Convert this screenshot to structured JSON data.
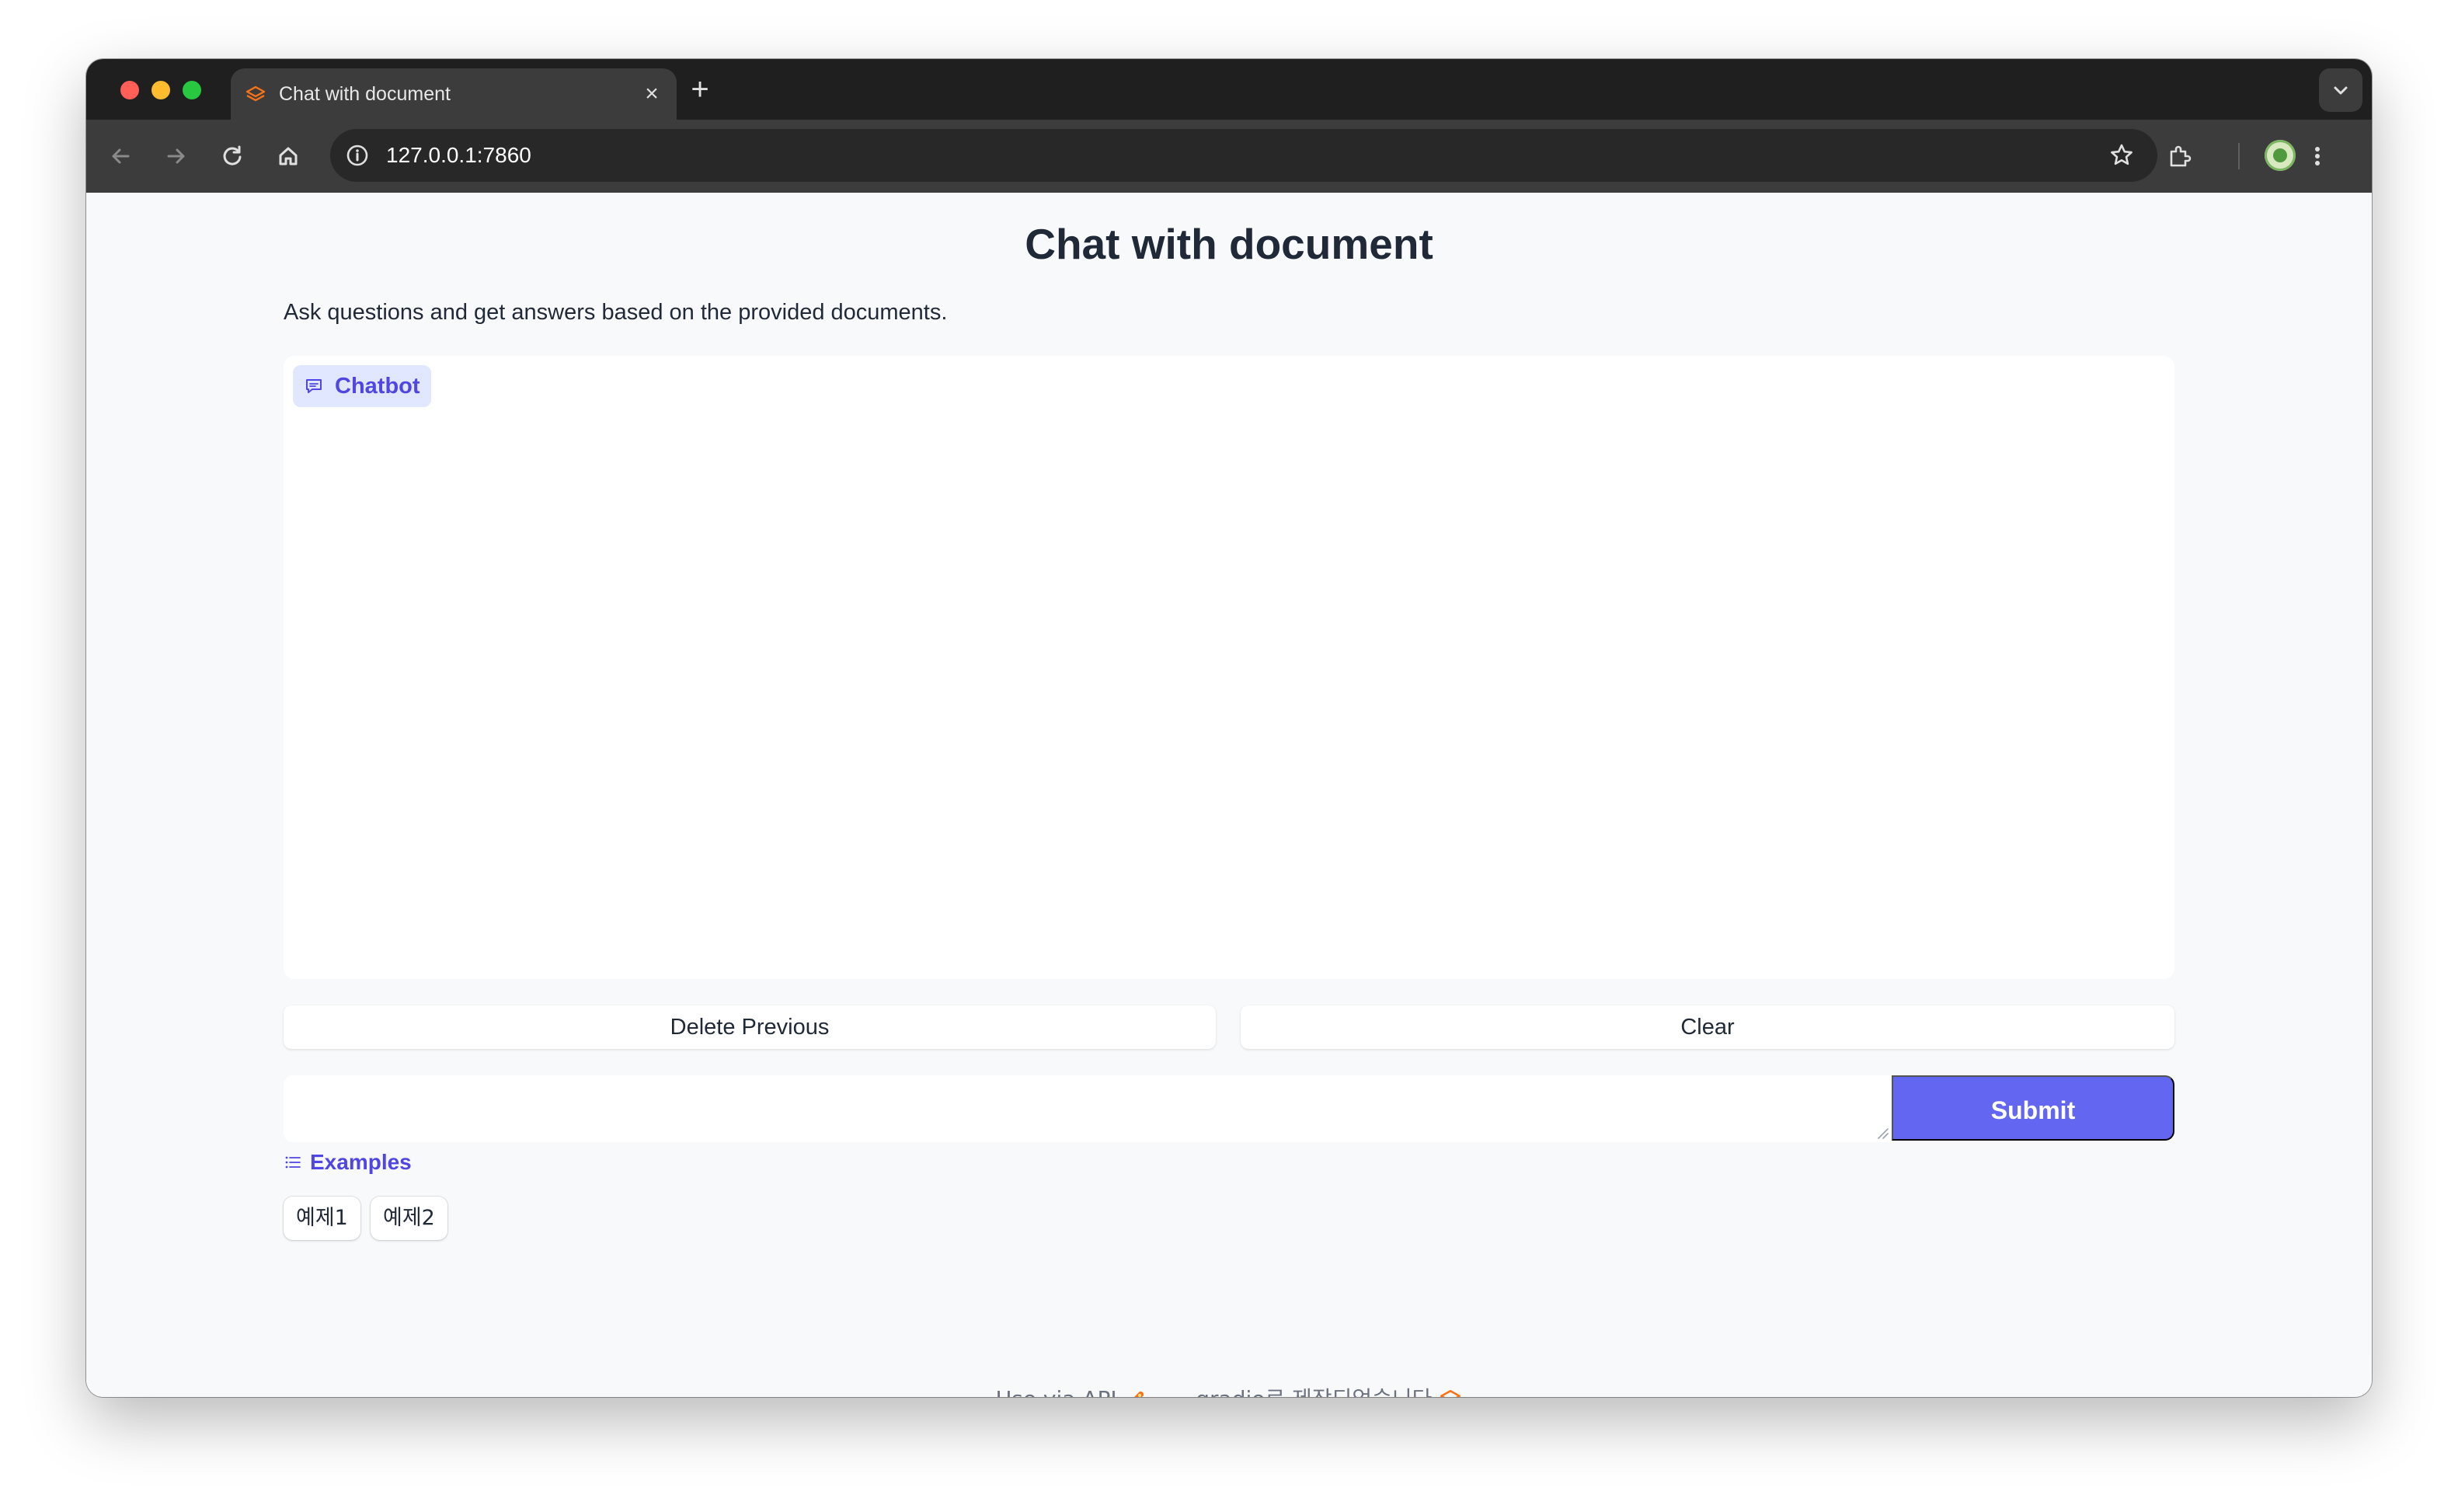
{
  "browser": {
    "tab_title": "Chat with document",
    "tab_close": "×",
    "new_tab": "+",
    "url": "127.0.0.1:7860",
    "icons": [
      "back-icon",
      "forward-icon",
      "reload-icon",
      "home-icon",
      "site-info-icon",
      "bookmark-star-icon",
      "extensions-icon",
      "profile-avatar",
      "menu-icon"
    ]
  },
  "page": {
    "title": "Chat with document",
    "description": "Ask questions and get answers based on the provided documents."
  },
  "chatbot": {
    "label": "Chatbot"
  },
  "buttons": {
    "delete_previous": "Delete Previous",
    "clear": "Clear",
    "submit": "Submit"
  },
  "input": {
    "value": "",
    "placeholder": ""
  },
  "examples": {
    "label": "Examples",
    "items": [
      "예제1",
      "예제2"
    ]
  },
  "footer": {
    "api_text": "Use via API",
    "separator": "·",
    "built_with": "gradio로 제작되었습니다"
  },
  "colors": {
    "accent": "#6366f1",
    "accent_text": "#4f46e5",
    "label_bg": "#e0e7ff",
    "gradio_orange": "#f97316"
  }
}
